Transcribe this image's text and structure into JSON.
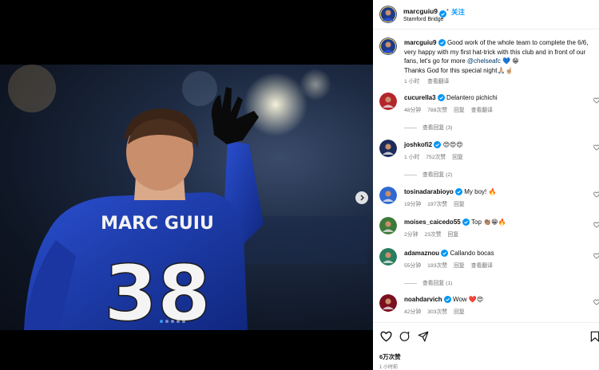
{
  "post": {
    "username": "marcguiu9",
    "separator": "•",
    "follow_label": "关注",
    "location": "Stamford Bridge",
    "jersey_name": "MARC GUIU",
    "jersey_number": "38",
    "carousel_total": 5,
    "carousel_active": 1
  },
  "caption": {
    "username": "marcguiu9",
    "text_before_mention": "Good work of the whole team to complete the 6/6, very happy with my first hat-trick with this club and in front of our fans, let's go for more ",
    "mention": "@chelseafc",
    "text_after_mention": " 💙 😁",
    "line2": "Thanks God for this special night🙏🏼☝🏼",
    "time": "1 小时",
    "translate": "查看翻译"
  },
  "comments": [
    {
      "username": "cucurella3",
      "verified": true,
      "text": "Delantero pichichi",
      "time": "48分钟",
      "likes": "788次赞",
      "reply": "回复",
      "translate": "查看翻译",
      "view_replies": "查看回复 (3)",
      "avatar_color": "#b3262c"
    },
    {
      "username": "joshkofi2",
      "verified": true,
      "text": "😍😍😍",
      "time": "1 小时",
      "likes": "752次赞",
      "reply": "回复",
      "translate": "",
      "view_replies": "查看回复 (2)",
      "avatar_color": "#1d2c5a"
    },
    {
      "username": "tosinadarabioyo",
      "verified": true,
      "text": "My boy! 🔥",
      "time": "19分钟",
      "likes": "197次赞",
      "reply": "回复",
      "translate": "",
      "view_replies": "",
      "avatar_color": "#2f6ad0"
    },
    {
      "username": "moises_caicedo55",
      "verified": true,
      "text": "Top 👏🏽😁🔥",
      "time": "2分钟",
      "likes": "23次赞",
      "reply": "回复",
      "translate": "",
      "view_replies": "",
      "avatar_color": "#3d7a3a"
    },
    {
      "username": "adamaznou",
      "verified": true,
      "text": "Callando bocas",
      "time": "55分钟",
      "likes": "193次赞",
      "reply": "回复",
      "translate": "查看翻译",
      "view_replies": "查看回复 (1)",
      "avatar_color": "#2a7d5d"
    },
    {
      "username": "noahdarvich",
      "verified": true,
      "text": "Wow ❤️😍",
      "time": "42分钟",
      "likes": "303次赞",
      "reply": "回复",
      "translate": "",
      "view_replies": "",
      "avatar_color": "#7a1020"
    }
  ],
  "footer": {
    "likes": "6万次赞",
    "time": "1 小时前"
  },
  "icons": {
    "verified": "verified-badge-icon",
    "like": "heart-icon",
    "comment": "comment-icon",
    "share": "share-icon",
    "save": "bookmark-icon",
    "next": "chevron-right-icon"
  },
  "colors": {
    "link": "#0095f6",
    "mention": "#00376b",
    "secondary_text": "#737373",
    "verified": "#0095f6",
    "chelsea_blue": "#1b3fb0"
  }
}
